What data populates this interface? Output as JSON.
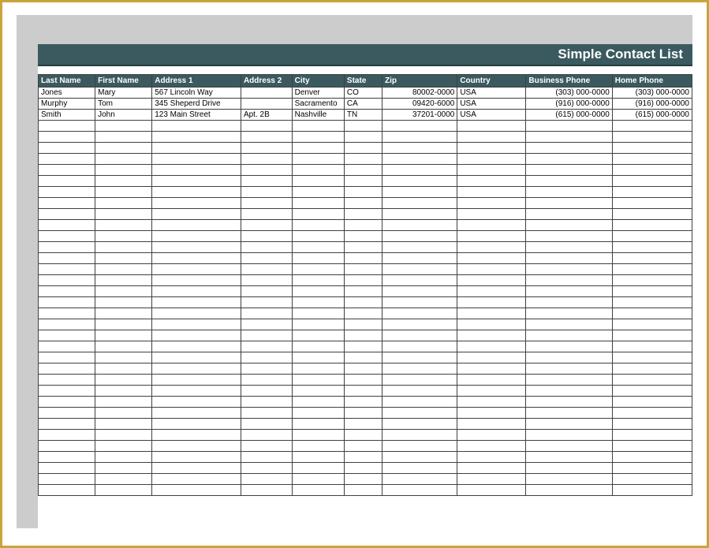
{
  "title": "Simple Contact List",
  "headers": {
    "last_name": "Last Name",
    "first_name": "First Name",
    "address1": "Address 1",
    "address2": "Address 2",
    "city": "City",
    "state": "State",
    "zip": "Zip",
    "country": "Country",
    "business_phone": "Business Phone",
    "home_phone": "Home Phone"
  },
  "rows": [
    {
      "last_name": "Jones",
      "first_name": "Mary",
      "address1": "567 Lincoln Way",
      "address2": "",
      "city": "Denver",
      "state": "CO",
      "zip": "80002-0000",
      "country": "USA",
      "business_phone": "(303) 000-0000",
      "home_phone": "(303) 000-0000"
    },
    {
      "last_name": "Murphy",
      "first_name": "Tom",
      "address1": "345 Sheperd Drive",
      "address2": "",
      "city": "Sacramento",
      "state": "CA",
      "zip": "09420-6000",
      "country": "USA",
      "business_phone": "(916) 000-0000",
      "home_phone": "(916) 000-0000"
    },
    {
      "last_name": "Smith",
      "first_name": "John",
      "address1": "123 Main Street",
      "address2": "Apt. 2B",
      "city": "Nashville",
      "state": "TN",
      "zip": "37201-0000",
      "country": "USA",
      "business_phone": "(615) 000-0000",
      "home_phone": "(615) 000-0000"
    }
  ],
  "empty_row_count": 34
}
